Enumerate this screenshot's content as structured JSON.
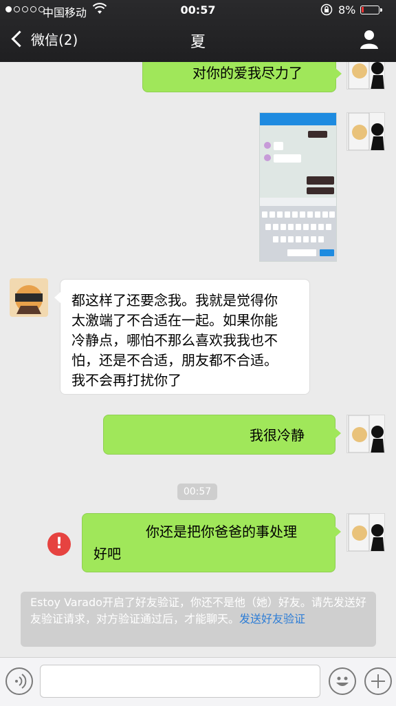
{
  "status_bar": {
    "carrier": "中国移动",
    "time": "00:57",
    "battery_percent": "8%",
    "battery_level": 0.08
  },
  "nav": {
    "back_label": "微信(2)",
    "title": "夏"
  },
  "messages": [
    {
      "side": "me",
      "text": "对你的爱我尽力了"
    },
    {
      "side": "me",
      "type": "image"
    },
    {
      "side": "other",
      "lines": [
        "都这样了还要念我。我就是觉得你",
        "太激端了不合适在一起。如果你能",
        "冷静点，哪怕不那么喜欢我我也不",
        "怕，还是不合适，朋友都不合适。",
        "我不会再打扰你了"
      ]
    },
    {
      "side": "me",
      "text": "我很冷静"
    },
    {
      "type": "timestamp",
      "text": "00:57"
    },
    {
      "side": "me",
      "lines": [
        "你还是把你爸爸的事处理",
        "好吧"
      ],
      "failed": true,
      "error_mark": "!"
    }
  ],
  "notice": {
    "text": "Estoy Varado开启了好友验证，你还不是他（她）好友。请先发送好友验证请求，对方验证通过后，才能聊天。",
    "link": "发送好友验证"
  },
  "input_bar": {
    "placeholder": ""
  }
}
